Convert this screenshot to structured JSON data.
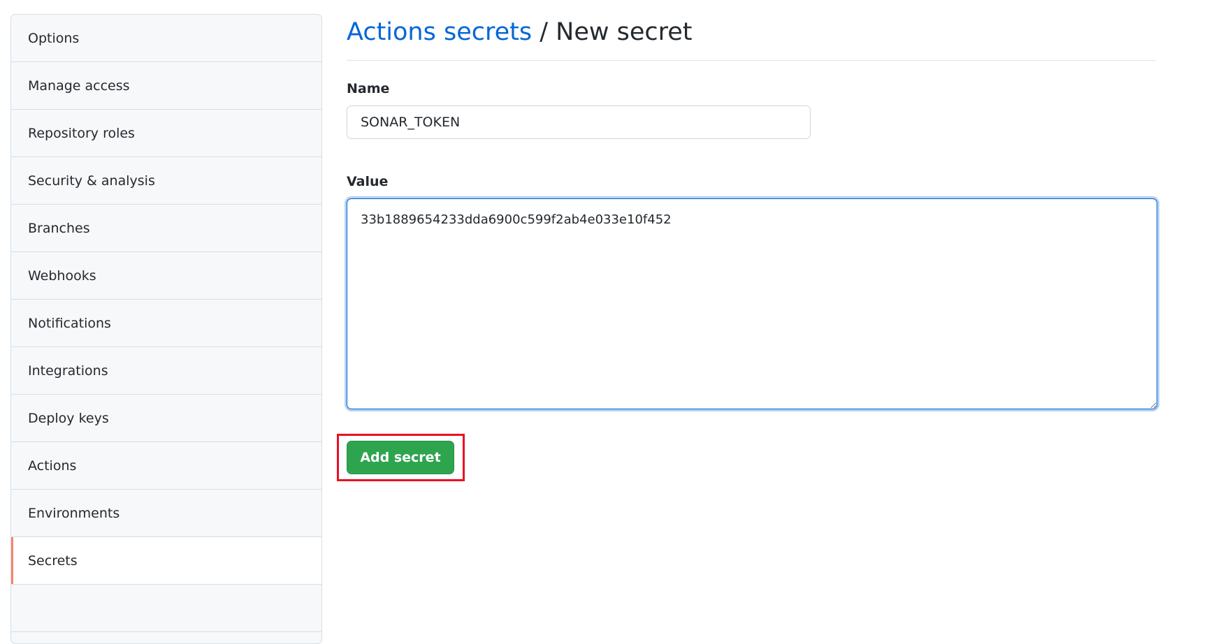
{
  "sidebar": {
    "items": [
      {
        "label": "Options"
      },
      {
        "label": "Manage access"
      },
      {
        "label": "Repository roles"
      },
      {
        "label": "Security & analysis"
      },
      {
        "label": "Branches"
      },
      {
        "label": "Webhooks"
      },
      {
        "label": "Notifications"
      },
      {
        "label": "Integrations"
      },
      {
        "label": "Deploy keys"
      },
      {
        "label": "Actions"
      },
      {
        "label": "Environments"
      },
      {
        "label": "Secrets",
        "active": true
      }
    ]
  },
  "header": {
    "breadcrumb": "Actions secrets",
    "separator": " / ",
    "title": "New secret"
  },
  "form": {
    "name_label": "Name",
    "name_value": "SONAR_TOKEN",
    "value_label": "Value",
    "value_value": "33b1889654233dda6900c599f2ab4e033e10f452",
    "submit_label": "Add secret"
  },
  "colors": {
    "accent": "#0366d6",
    "button": "#2ea44f",
    "highlight": "#e81123",
    "active_marker": "#f9826c"
  }
}
